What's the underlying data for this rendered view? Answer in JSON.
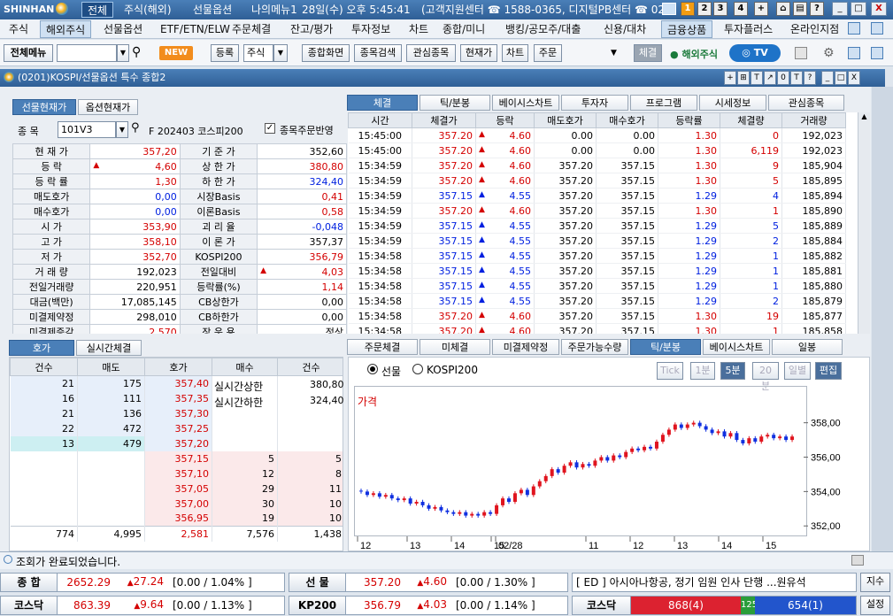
{
  "titlebar": {
    "brand": "SHINHAN",
    "menus": [
      "전체",
      "주식(해외)",
      "선물옵션",
      "나의메뉴1"
    ],
    "datetime": "28일(수) 오후 5:45:41",
    "support": "(고객지원센터 ☎ 1588-0365, 디지털PB센터 ☎ 02",
    "screen_buttons": [
      "1",
      "2",
      "3",
      "4",
      "+"
    ],
    "window_buttons": [
      "_",
      "□",
      "X"
    ]
  },
  "menubar": [
    "주식",
    "해외주식",
    "선물옵션",
    "ETF/ETN/ELW",
    "주문체결",
    "잔고/평가",
    "투자정보",
    "차트",
    "종합/미니",
    "뱅킹/공모주/대출",
    "신용/대차",
    "금융상품",
    "투자플러스",
    "온라인지점"
  ],
  "toolbar": {
    "all_menu": "전체메뉴",
    "new_badge": "NEW",
    "register": "등록",
    "stock_select": "주식",
    "buttons": [
      "종합화면",
      "종목검색",
      "관심종목",
      "현재가",
      "차트",
      "주문"
    ],
    "execution": "체결",
    "overseas": "해외주식",
    "tv": "TV"
  },
  "window": {
    "title": "(0201)KOSPI/선물옵션 특수 종합2"
  },
  "left_panel": {
    "tabs": [
      "선물현재가",
      "옵션현재가"
    ],
    "code_label": "종  목",
    "code": "101V3",
    "name": "F 202403 코스피200",
    "reflect_label": "종목주문반영",
    "rows": [
      {
        "l1": "현 재 가",
        "v1": "357,20",
        "c1": "red",
        "a1": "",
        "l2": "기 준 가",
        "v2": "352,60",
        "c2": "",
        "a2": ""
      },
      {
        "l1": "등   락",
        "v1": "4,60",
        "c1": "red",
        "a1": "▲",
        "l2": "상 한 가",
        "v2": "380,80",
        "c2": "red",
        "a2": ""
      },
      {
        "l1": "등 락 률",
        "v1": "1,30",
        "c1": "red",
        "a1": "",
        "l2": "하 한 가",
        "v2": "324,40",
        "c2": "blue",
        "a2": ""
      },
      {
        "l1": "매도호가",
        "v1": "0,00",
        "c1": "blue",
        "a1": "",
        "l2": "시장Basis",
        "v2": "0,41",
        "c2": "red",
        "a2": ""
      },
      {
        "l1": "매수호가",
        "v1": "0,00",
        "c1": "blue",
        "a1": "",
        "l2": "이론Basis",
        "v2": "0,58",
        "c2": "red",
        "a2": ""
      },
      {
        "l1": "시   가",
        "v1": "353,90",
        "c1": "red",
        "a1": "",
        "l2": "괴 리 율",
        "v2": "-0,048",
        "c2": "blue",
        "a2": ""
      },
      {
        "l1": "고   가",
        "v1": "358,10",
        "c1": "red",
        "a1": "",
        "l2": "이 론 가",
        "v2": "357,37",
        "c2": "",
        "a2": ""
      },
      {
        "l1": "저   가",
        "v1": "352,70",
        "c1": "red",
        "a1": "",
        "l2": "KOSPI200",
        "v2": "356,79",
        "c2": "red",
        "a2": ""
      },
      {
        "l1": "거 래 량",
        "v1": "192,023",
        "c1": "",
        "a1": "",
        "l2": "전일대비",
        "v2": "4,03",
        "c2": "red",
        "a2": "▲"
      },
      {
        "l1": "전일거래량",
        "v1": "220,951",
        "c1": "",
        "a1": "",
        "l2": "등락률(%)",
        "v2": "1,14",
        "c2": "red",
        "a2": ""
      },
      {
        "l1": "대금(백만)",
        "v1": "17,085,145",
        "c1": "",
        "a1": "",
        "l2": "CB상한가",
        "v2": "0,00",
        "c2": "",
        "a2": ""
      },
      {
        "l1": "미결제약정",
        "v1": "298,010",
        "c1": "",
        "a1": "",
        "l2": "CB하한가",
        "v2": "0,00",
        "c2": "",
        "a2": ""
      },
      {
        "l1": "미결제증감",
        "v1": "2,570",
        "c1": "red",
        "a1": "",
        "l2": "장 운 용",
        "v2": "정상",
        "c2": "",
        "a2": ""
      }
    ]
  },
  "tick_panel": {
    "tabs": [
      "체결",
      "틱/분봉",
      "베이시스차트",
      "투자자",
      "프로그램",
      "시세정보",
      "관심종목"
    ],
    "headers": [
      "시간",
      "체결가",
      "등락",
      "매도호가",
      "매수호가",
      "등락률",
      "체결량",
      "거래량"
    ],
    "rows": [
      {
        "t": "15:45:00",
        "p": "357.20",
        "d": "4.60",
        "ask": "0.00",
        "bid": "0.00",
        "r": "1.30",
        "q": "0",
        "qc": "red",
        "v": "192,023"
      },
      {
        "t": "15:45:00",
        "p": "357.20",
        "d": "4.60",
        "ask": "0.00",
        "bid": "0.00",
        "r": "1.30",
        "q": "6,119",
        "qc": "red",
        "v": "192,023"
      },
      {
        "t": "15:34:59",
        "p": "357.20",
        "d": "4.60",
        "ask": "357.20",
        "bid": "357.15",
        "r": "1.30",
        "q": "9",
        "qc": "red",
        "v": "185,904"
      },
      {
        "t": "15:34:59",
        "p": "357.20",
        "d": "4.60",
        "ask": "357.20",
        "bid": "357.15",
        "r": "1.30",
        "q": "5",
        "qc": "red",
        "v": "185,895"
      },
      {
        "t": "15:34:59",
        "p": "357.15",
        "d": "4.55",
        "ask": "357.20",
        "bid": "357.15",
        "r": "1.29",
        "q": "4",
        "qc": "blue",
        "v": "185,894"
      },
      {
        "t": "15:34:59",
        "p": "357.20",
        "d": "4.60",
        "ask": "357.20",
        "bid": "357.15",
        "r": "1.30",
        "q": "1",
        "qc": "red",
        "v": "185,890"
      },
      {
        "t": "15:34:59",
        "p": "357.15",
        "d": "4.55",
        "ask": "357.20",
        "bid": "357.15",
        "r": "1.29",
        "q": "5",
        "qc": "blue",
        "v": "185,889"
      },
      {
        "t": "15:34:59",
        "p": "357.15",
        "d": "4.55",
        "ask": "357.20",
        "bid": "357.15",
        "r": "1.29",
        "q": "2",
        "qc": "blue",
        "v": "185,884"
      },
      {
        "t": "15:34:58",
        "p": "357.15",
        "d": "4.55",
        "ask": "357.20",
        "bid": "357.15",
        "r": "1.29",
        "q": "1",
        "qc": "blue",
        "v": "185,882"
      },
      {
        "t": "15:34:58",
        "p": "357.15",
        "d": "4.55",
        "ask": "357.20",
        "bid": "357.15",
        "r": "1.29",
        "q": "1",
        "qc": "blue",
        "v": "185,881"
      },
      {
        "t": "15:34:58",
        "p": "357.15",
        "d": "4.55",
        "ask": "357.20",
        "bid": "357.15",
        "r": "1.29",
        "q": "1",
        "qc": "blue",
        "v": "185,880"
      },
      {
        "t": "15:34:58",
        "p": "357.15",
        "d": "4.55",
        "ask": "357.20",
        "bid": "357.15",
        "r": "1.29",
        "q": "2",
        "qc": "blue",
        "v": "185,879"
      },
      {
        "t": "15:34:58",
        "p": "357.20",
        "d": "4.60",
        "ask": "357.20",
        "bid": "357.15",
        "r": "1.30",
        "q": "19",
        "qc": "red",
        "v": "185,877"
      },
      {
        "t": "15:34:58",
        "p": "357.20",
        "d": "4.60",
        "ask": "357.20",
        "bid": "357.15",
        "r": "1.30",
        "q": "1",
        "qc": "red",
        "v": "185,858"
      }
    ]
  },
  "orderbook": {
    "tabs": [
      "호가",
      "실시간체결"
    ],
    "headers": [
      "건수",
      "매도",
      "호가",
      "매수",
      "건수"
    ],
    "asks": [
      {
        "cnt": "21",
        "qty": "175",
        "price": "357,40"
      },
      {
        "cnt": "16",
        "qty": "111",
        "price": "357,35"
      },
      {
        "cnt": "21",
        "qty": "136",
        "price": "357,30"
      },
      {
        "cnt": "22",
        "qty": "472",
        "price": "357,25"
      },
      {
        "cnt": "13",
        "qty": "479",
        "price": "357,20"
      }
    ],
    "bids": [
      {
        "price": "357,15",
        "qty": "5",
        "cnt": "5"
      },
      {
        "price": "357,10",
        "qty": "12",
        "cnt": "8"
      },
      {
        "price": "357,05",
        "qty": "29",
        "cnt": "11"
      },
      {
        "price": "357,00",
        "qty": "30",
        "cnt": "10"
      },
      {
        "price": "356,95",
        "qty": "19",
        "cnt": "10"
      }
    ],
    "upper_label": "실시간상한",
    "upper_value": "380,80",
    "lower_label": "실시간하한",
    "lower_value": "324,40",
    "totals": {
      "ask_cnt": "774",
      "ask_qty": "4,995",
      "diff": "2,581",
      "bid_qty": "7,576",
      "bid_cnt": "1,438"
    }
  },
  "chart_panel": {
    "tabs": [
      "주문체결",
      "미체결",
      "미결제약정",
      "주문가능수량",
      "틱/분봉",
      "베이시스차트",
      "일봉"
    ],
    "radio_futures": "선물",
    "radio_kospi": "KOSPI200",
    "interval_buttons": [
      "Tick",
      "1분",
      "5분",
      "20분",
      "일별"
    ],
    "edit_button": "편집",
    "label": "가격"
  },
  "chart_data": {
    "type": "candlestick",
    "title": "가격",
    "y_ticks": [
      "358,00",
      "356,00",
      "354,00",
      "352,00"
    ],
    "ylim": [
      351.6,
      358.6
    ],
    "x_ticks": [
      "12",
      "13",
      "14",
      "15",
      "02/28",
      "11",
      "12",
      "13",
      "14",
      "15"
    ],
    "closes": [
      354.0,
      353.8,
      353.9,
      353.7,
      353.8,
      353.6,
      353.5,
      353.6,
      353.3,
      353.4,
      353.2,
      353.0,
      353.1,
      352.9,
      352.8,
      352.7,
      352.8,
      352.6,
      352.7,
      352.6,
      352.8,
      352.7,
      353.2,
      353.6,
      353.4,
      353.9,
      354.1,
      353.8,
      354.3,
      354.6,
      354.9,
      355.3,
      355.1,
      355.5,
      355.7,
      355.4,
      355.6,
      355.5,
      355.8,
      356.0,
      355.8,
      356.1,
      356.0,
      356.3,
      356.5,
      356.4,
      356.6,
      356.5,
      356.9,
      357.3,
      357.6,
      357.9,
      357.7,
      357.9,
      358.0,
      357.8,
      357.6,
      357.4,
      357.5,
      357.2,
      357.4,
      357.0,
      356.8,
      357.1,
      356.9,
      357.2,
      357.3,
      357.1,
      357.2,
      357.0,
      357.2
    ]
  },
  "status": {
    "message": "조회가 완료되었습니다.",
    "t1": {
      "label": "종  합",
      "value": "2652.29",
      "change": "27.24",
      "extra": "[0.00  / 1.04%  ]"
    },
    "t2": {
      "label": "선  물",
      "value": "357.20",
      "change": "4.60",
      "extra": "[0.00  / 1.30%  ]"
    },
    "news": "[ ED ] 아시아나항공, 정기 임원 인사 단행 ...원유석",
    "news_btn": "지수",
    "t3": {
      "label": "코스닥",
      "value": "863.39",
      "change": "9.64",
      "extra": "[0.00  / 1.13%  ]"
    },
    "t4": {
      "label": "KP200",
      "value": "356.79",
      "change": "4.03",
      "extra": "[0.00  / 1.14%  ]"
    },
    "t5_label": "코스닥",
    "adv": "868(4)",
    "flat": "125",
    "dec": "654(1)",
    "settings": "설정"
  }
}
